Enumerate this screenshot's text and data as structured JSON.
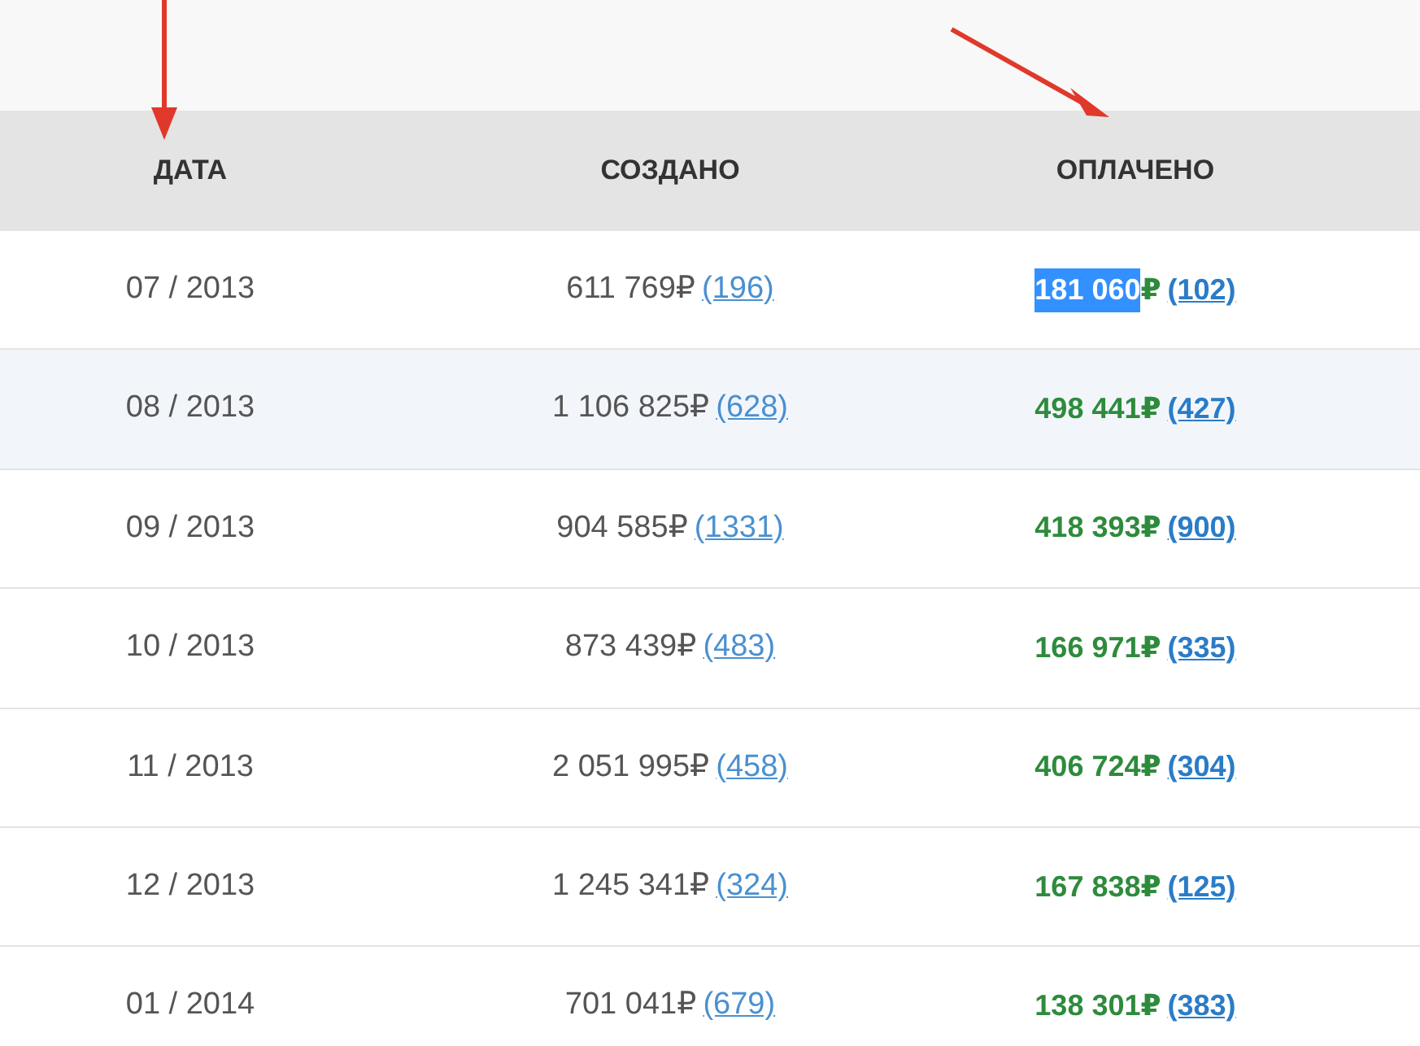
{
  "columns": [
    {
      "label": "ДАТА"
    },
    {
      "label": "СОЗДАНО"
    },
    {
      "label": "ОПЛАЧЕНО"
    }
  ],
  "rows": [
    {
      "date": "07 / 2013",
      "highlighted": false,
      "created": {
        "amount": "611 769",
        "currency": "₽",
        "count": "(196)"
      },
      "paid": {
        "amount": "181 060",
        "currency": "₽",
        "count": "(102)",
        "selected": true
      }
    },
    {
      "date": "08 / 2013",
      "highlighted": true,
      "created": {
        "amount": "1 106 825",
        "currency": "₽",
        "count": "(628)"
      },
      "paid": {
        "amount": "498 441",
        "currency": "₽",
        "count": "(427)",
        "selected": false
      }
    },
    {
      "date": "09 / 2013",
      "highlighted": false,
      "created": {
        "amount": "904 585",
        "currency": "₽",
        "count": "(1331)"
      },
      "paid": {
        "amount": "418 393",
        "currency": "₽",
        "count": "(900)",
        "selected": false
      }
    },
    {
      "date": "10 / 2013",
      "highlighted": false,
      "created": {
        "amount": "873 439",
        "currency": "₽",
        "count": "(483)"
      },
      "paid": {
        "amount": "166 971",
        "currency": "₽",
        "count": "(335)",
        "selected": false
      }
    },
    {
      "date": "11 / 2013",
      "highlighted": false,
      "created": {
        "amount": "2 051 995",
        "currency": "₽",
        "count": "(458)"
      },
      "paid": {
        "amount": "406 724",
        "currency": "₽",
        "count": "(304)",
        "selected": false
      }
    },
    {
      "date": "12 / 2013",
      "highlighted": false,
      "created": {
        "amount": "1 245 341",
        "currency": "₽",
        "count": "(324)"
      },
      "paid": {
        "amount": "167 838",
        "currency": "₽",
        "count": "(125)",
        "selected": false
      }
    },
    {
      "date": "01 / 2014",
      "highlighted": false,
      "created": {
        "amount": "701 041",
        "currency": "₽",
        "count": "(679)"
      },
      "paid": {
        "amount": "138 301",
        "currency": "₽",
        "count": "(383)",
        "selected": false
      }
    }
  ]
}
